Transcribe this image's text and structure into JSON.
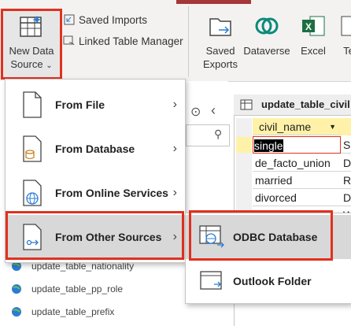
{
  "ribbon": {
    "new_data_source_line1": "New Data",
    "new_data_source_line2": "Source",
    "saved_imports": "Saved Imports",
    "linked_table_manager": "Linked Table Manager",
    "saved_exports_line1": "Saved",
    "saved_exports_line2": "Exports",
    "dataverse": "Dataverse",
    "excel": "Excel",
    "text_file_partial": "Te"
  },
  "menu": {
    "items": [
      {
        "label": "From File",
        "chevron": "›"
      },
      {
        "label": "From Database",
        "chevron": "›"
      },
      {
        "label": "From Online Services",
        "chevron": "›"
      },
      {
        "label": "From Other Sources",
        "chevron": "›"
      }
    ]
  },
  "submenu": {
    "items": [
      {
        "label": "ODBC Database"
      },
      {
        "label": "Outlook Folder"
      }
    ]
  },
  "nav": {
    "items": [
      {
        "label": "update_table_nationality"
      },
      {
        "label": "update_table_pp_role"
      },
      {
        "label": "update_table_prefix"
      }
    ]
  },
  "table": {
    "tab_title": "update_table_civil",
    "column_header": "civil_name",
    "rows": [
      {
        "name": "single",
        "next": "Si"
      },
      {
        "name": "de_facto_union",
        "next": "D"
      },
      {
        "name": "married",
        "next": "R"
      },
      {
        "name": "divorced",
        "next": "D"
      },
      {
        "name": "",
        "next": "W"
      }
    ]
  },
  "colors": {
    "highlight_red": "#e0311f",
    "selected_menu": "#d8d8d8",
    "excel_green": "#1d6f42",
    "dataverse_teal": "#0b8a7a",
    "access_red": "#a4373a"
  }
}
